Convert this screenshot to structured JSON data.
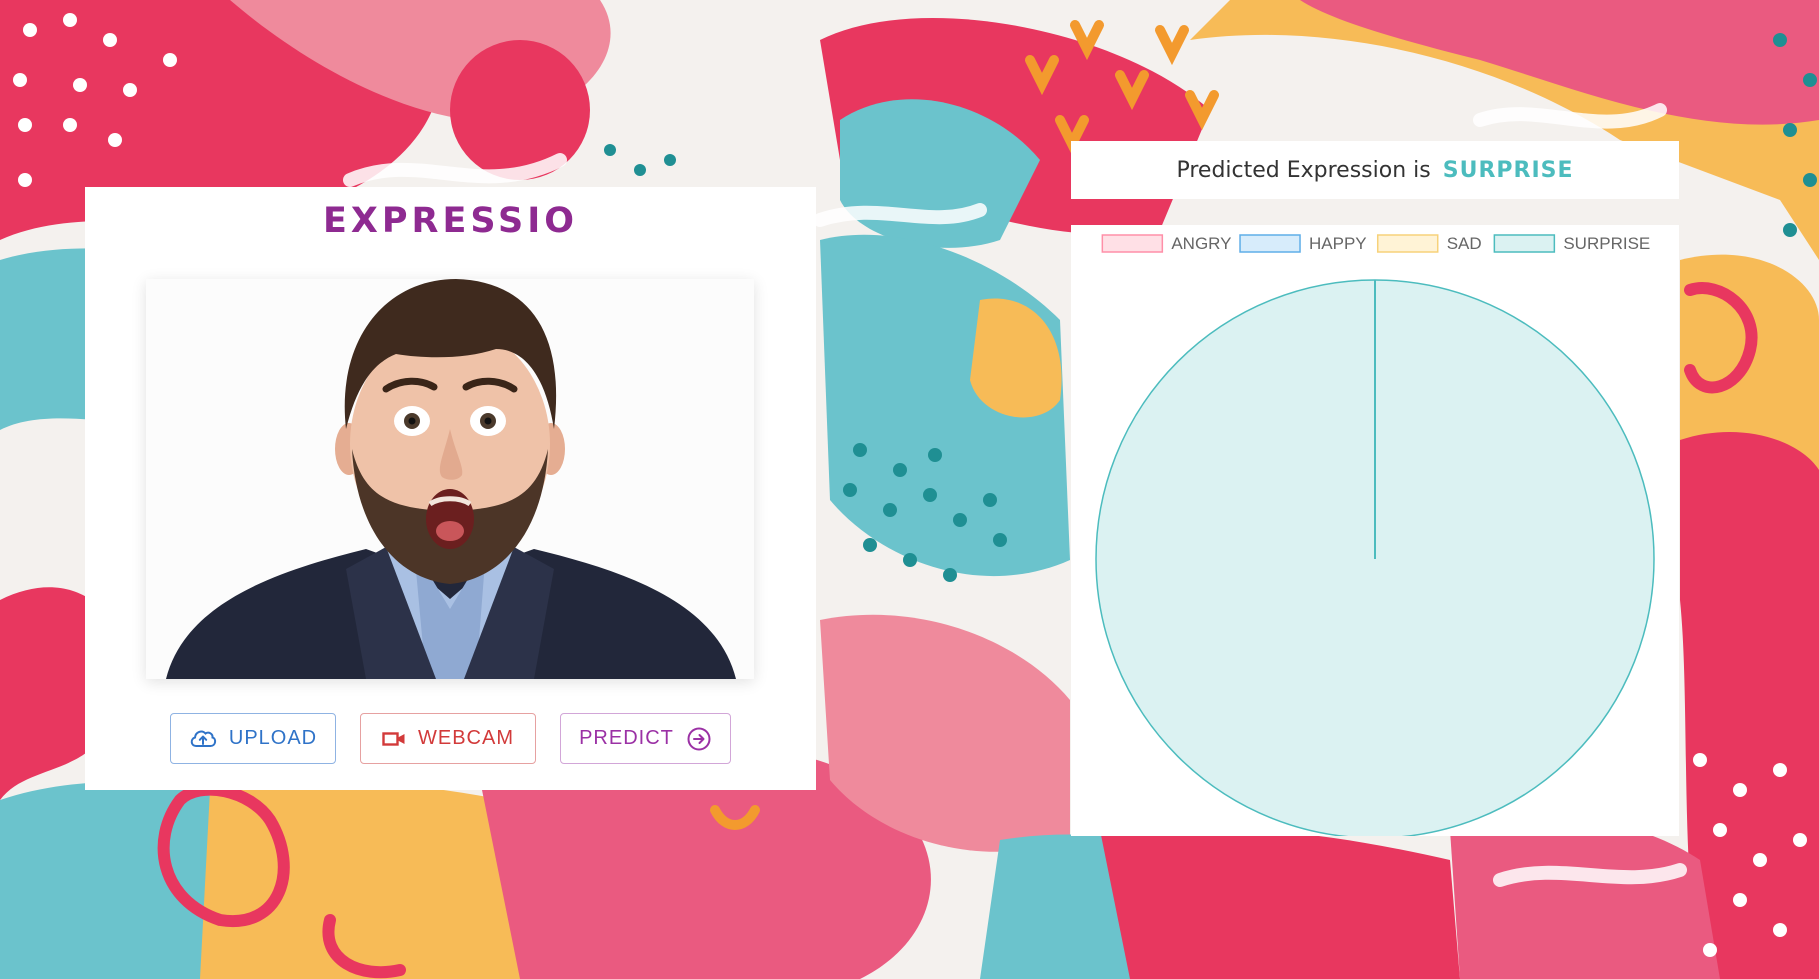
{
  "app": {
    "title": "EXPRESSIO"
  },
  "image": {
    "subject": "surprised man with beard in suit"
  },
  "buttons": {
    "upload": {
      "label": "UPLOAD",
      "icon": "cloud-upload-icon"
    },
    "webcam": {
      "label": "WEBCAM",
      "icon": "video-camera-icon"
    },
    "predict": {
      "label": "PREDICT",
      "icon": "arrow-right-circle-icon"
    }
  },
  "result": {
    "prefix": "Predicted Expression is",
    "value": "SURPRISE"
  },
  "colors": {
    "title": "#8e2a91",
    "accent": "#4cbcbe",
    "upload": "#2f73c8",
    "webcam": "#d23a3a",
    "predict": "#9b31a5"
  },
  "chart_data": {
    "type": "pie",
    "categories": [
      "ANGRY",
      "HAPPY",
      "SAD",
      "SURPRISE"
    ],
    "values": [
      0,
      0,
      0,
      100
    ],
    "legend": "top",
    "series_colors": {
      "ANGRY": {
        "fill": "#ffe0e6",
        "stroke": "#ff8fa8"
      },
      "HAPPY": {
        "fill": "#d7ecfb",
        "stroke": "#5faee8"
      },
      "SAD": {
        "fill": "#fff3d6",
        "stroke": "#f7d27a"
      },
      "SURPRISE": {
        "fill": "#dbf2f2",
        "stroke": "#4cbcbe"
      }
    }
  }
}
